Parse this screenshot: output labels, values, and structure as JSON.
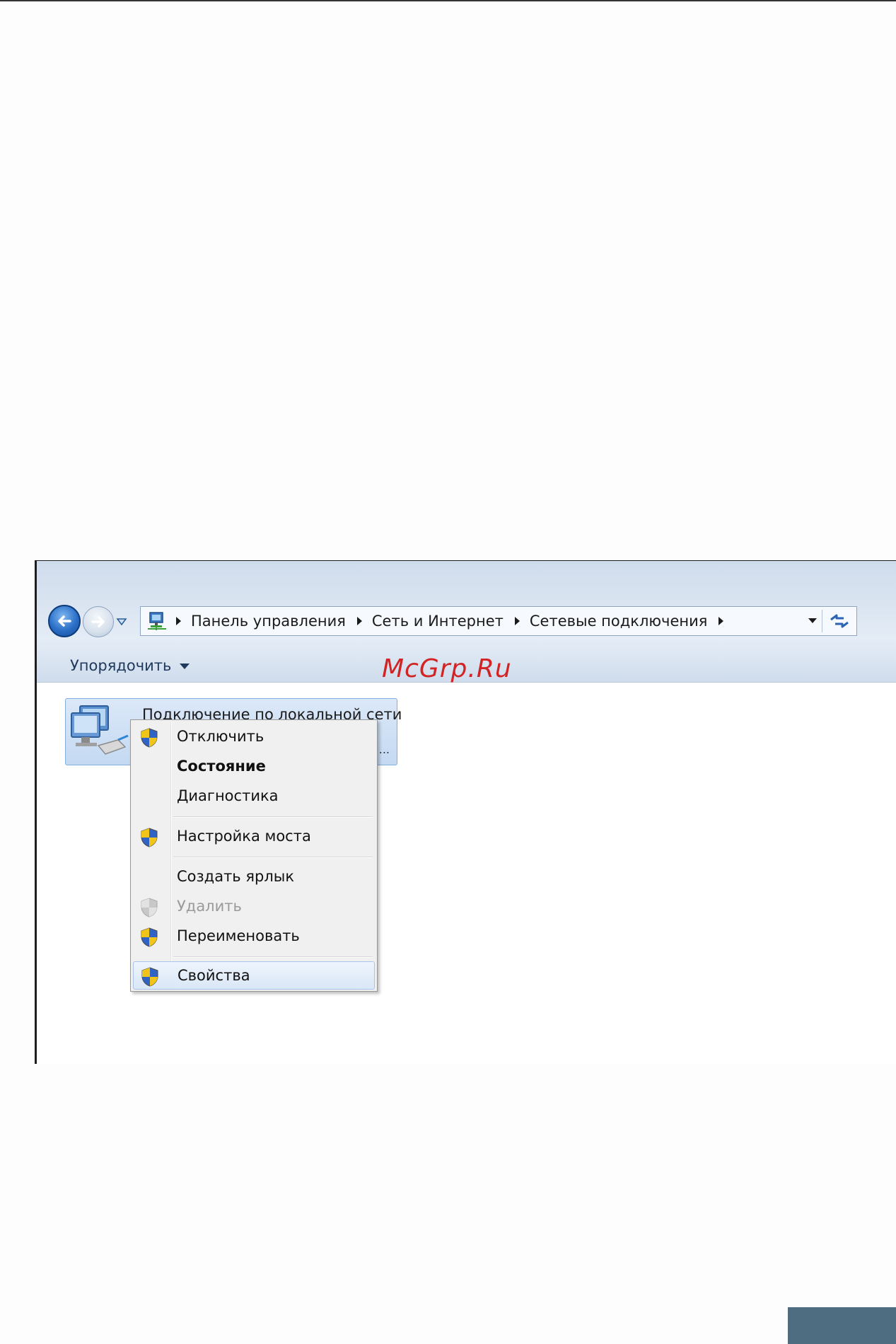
{
  "address_bar": {
    "breadcrumbs": [
      "Панель управления",
      "Сеть и Интернет",
      "Сетевые подключения"
    ]
  },
  "toolbar": {
    "organize_label": "Упорядочить"
  },
  "watermark": "McGrp.Ru",
  "connection": {
    "name": "Подключение по локальной сети",
    "truncated_marker": "..."
  },
  "context_menu": {
    "items": [
      {
        "label": "Отключить",
        "shield": true,
        "bold": false,
        "disabled": false
      },
      {
        "label": "Состояние",
        "shield": false,
        "bold": true,
        "disabled": false
      },
      {
        "label": "Диагностика",
        "shield": false,
        "bold": false,
        "disabled": false
      },
      {
        "label": "Настройка моста",
        "shield": true,
        "bold": false,
        "disabled": false
      },
      {
        "label": "Создать ярлык",
        "shield": false,
        "bold": false,
        "disabled": false
      },
      {
        "label": "Удалить",
        "shield": true,
        "bold": false,
        "disabled": true
      },
      {
        "label": "Переименовать",
        "shield": true,
        "bold": false,
        "disabled": false
      },
      {
        "label": "Свойства",
        "shield": true,
        "bold": false,
        "disabled": false,
        "highlighted": true
      }
    ]
  },
  "colors": {
    "watermark": "#d22424",
    "toolbar_text": "#1e395b",
    "selection": "#c4d9f2",
    "footer_box": "#4e6d80"
  },
  "icons": {
    "back": "back-arrow-icon",
    "forward": "forward-arrow-icon",
    "address": "network-connections-icon",
    "refresh": "refresh-icon",
    "shield": "uac-shield-icon",
    "connection": "network-adapter-icon"
  }
}
